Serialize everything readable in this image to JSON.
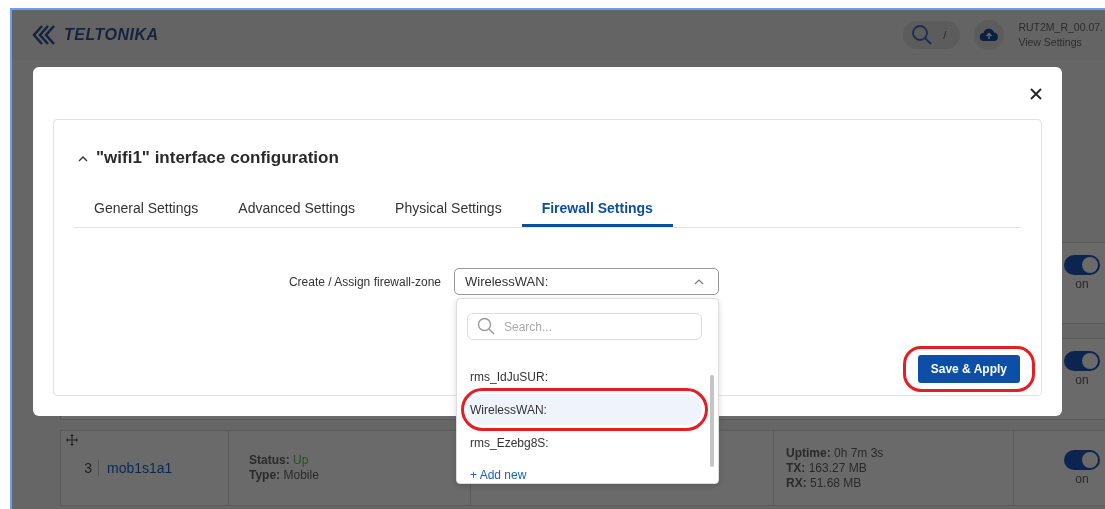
{
  "header": {
    "brand": "TELTONIKA",
    "search_shortcut": "/",
    "device_name": "RUT2M_R_00.07.",
    "device_link": "View Settings"
  },
  "background_rows": [
    {
      "toggle": {
        "on": true,
        "label": "on"
      }
    },
    {
      "toggle": {
        "on": true,
        "label": "on"
      }
    }
  ],
  "interface_row": {
    "index": "3",
    "name": "mob1s1a1",
    "status_label": "Status:",
    "status": "Up",
    "type_label": "Type:",
    "type": "Mobile",
    "stats": [
      {
        "label": "Uptime:",
        "value": "0h 7m 3s"
      },
      {
        "label": "TX:",
        "value": "163.27 MB"
      },
      {
        "label": "RX:",
        "value": "51.68 MB"
      }
    ],
    "toggle": {
      "on": true,
      "label": "on"
    }
  },
  "modal": {
    "title": "\"wifi1\" interface configuration",
    "expanded": true,
    "tabs": [
      {
        "label": "General Settings",
        "selected": false
      },
      {
        "label": "Advanced Settings",
        "selected": false
      },
      {
        "label": "Physical Settings",
        "selected": false
      },
      {
        "label": "Firewall Settings",
        "selected": true
      }
    ],
    "field": {
      "label": "Create / Assign firewall-zone",
      "value": "WirelessWAN:",
      "open": true
    },
    "dropdown": {
      "search_placeholder": "Search...",
      "options": [
        {
          "label": "rms_IdJuSUR:",
          "selected": false,
          "highlighted": false
        },
        {
          "label": "WirelessWAN:",
          "selected": true,
          "highlighted": true
        },
        {
          "label": "rms_Ezebg8S:",
          "selected": false,
          "highlighted": false
        }
      ],
      "add_new": "+ Add new"
    },
    "save_button": {
      "label": "Save & Apply",
      "highlighted": true
    }
  }
}
